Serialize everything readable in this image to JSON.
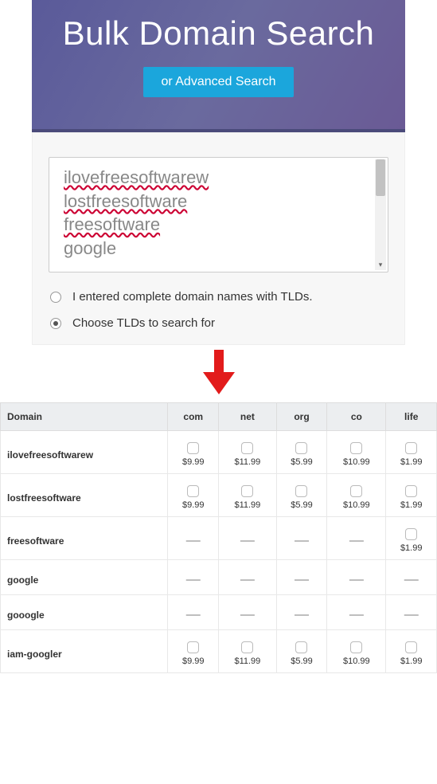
{
  "hero": {
    "title": "Bulk Domain Search",
    "adv_label": "or Advanced Search"
  },
  "textarea_lines": [
    "ilovefreesoftwarew",
    "lostfreesoftware",
    "freesoftware",
    "google"
  ],
  "textarea_spellflags": [
    true,
    true,
    true,
    false
  ],
  "options": {
    "opt_complete": "I entered complete domain names with TLDs.",
    "opt_choose": "Choose TLDs to search for",
    "selected": "choose"
  },
  "table": {
    "header_domain": "Domain",
    "tlds": [
      "com",
      "net",
      "org",
      "co",
      "life"
    ],
    "rows": [
      {
        "domain": "ilovefreesoftwarew",
        "cells": [
          "$9.99",
          "$11.99",
          "$5.99",
          "$10.99",
          "$1.99"
        ]
      },
      {
        "domain": "lostfreesoftware",
        "cells": [
          "$9.99",
          "$11.99",
          "$5.99",
          "$10.99",
          "$1.99"
        ]
      },
      {
        "domain": "freesoftware",
        "cells": [
          null,
          null,
          null,
          null,
          "$1.99"
        ]
      },
      {
        "domain": "google",
        "cells": [
          null,
          null,
          null,
          null,
          null
        ]
      },
      {
        "domain": "gooogle",
        "cells": [
          null,
          null,
          null,
          null,
          null
        ]
      },
      {
        "domain": "iam-googler",
        "cells": [
          "$9.99",
          "$11.99",
          "$5.99",
          "$10.99",
          "$1.99"
        ]
      }
    ]
  }
}
